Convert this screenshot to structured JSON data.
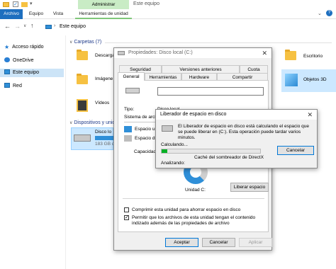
{
  "explorer": {
    "window_title": "Este equipo",
    "ribbon": {
      "context_label": "Administrar",
      "tabs": [
        "Archivo",
        "Equipo",
        "Vista",
        "Herramientas de unidad"
      ]
    },
    "address": "Este equipo",
    "sidebar": [
      {
        "label": "Acceso rápido"
      },
      {
        "label": "OneDrive"
      },
      {
        "label": "Este equipo"
      },
      {
        "label": "Red"
      }
    ],
    "folders_header": "Carpetas (7)",
    "folders": [
      "Descarga",
      "Imágene",
      "Vídeos",
      "Escritorio",
      "Objetos 3D"
    ],
    "devices_header": "Dispositivos y unid",
    "drive": {
      "name": "Disco lo",
      "size": "183 GB d"
    }
  },
  "properties": {
    "title": "Propiedades: Disco local (C:)",
    "tabs_row1": [
      "Seguridad",
      "Versiones anteriores",
      "Cuota"
    ],
    "tabs_row2": [
      "General",
      "Herramientas",
      "Hardware",
      "Compartir"
    ],
    "type_label": "Tipo:",
    "type_value": "Disco local",
    "fs_label": "Sistema de archiv",
    "used_label": "Espacio usa",
    "free_label": "Espacio dis",
    "capacity_label": "Capacidad:",
    "unit_label": "Unidad C:",
    "cleanup_button": "Liberar espacio",
    "compress_label": "Comprimir esta unidad para ahorrar espacio en disco",
    "index_label": "Permitir que los archivos de esta unidad tengan el contenido indizado además de las propiedades de archivo",
    "ok": "Aceptar",
    "cancel": "Cancelar",
    "apply": "Aplicar",
    "colors": {
      "used": "#2f8fd8",
      "free": "#bdbdbd"
    }
  },
  "cleanup": {
    "title": "Liberador de espacio en disco",
    "message": "El Liberador de espacio en disco está calculando el espacio que se puede liberar en  (C:). Esta operación puede tardar varios minutos.",
    "calculating": "Calculando...",
    "cancel": "Cancelar",
    "progress": 0.06,
    "current_item": "Caché del sombreador de DirectX",
    "scanning": "Analizando:"
  }
}
